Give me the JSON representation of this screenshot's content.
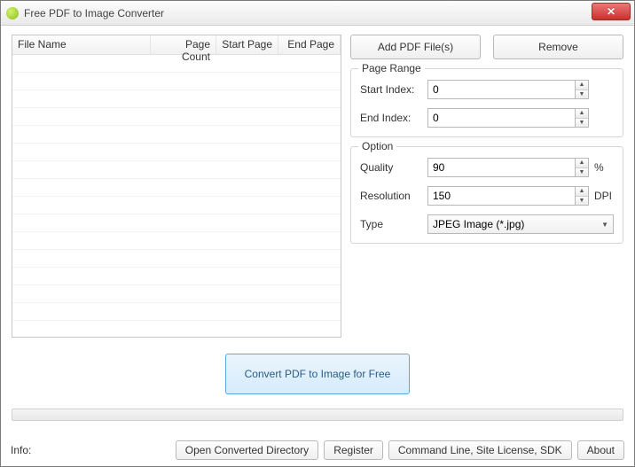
{
  "window": {
    "title": "Free PDF to Image Converter"
  },
  "file_list": {
    "headers": {
      "file_name": "File Name",
      "page_count": "Page Count",
      "start_page": "Start Page",
      "end_page": "End Page"
    }
  },
  "buttons": {
    "add": "Add PDF File(s)",
    "remove": "Remove",
    "convert": "Convert PDF to Image for Free",
    "open_dir": "Open Converted Directory",
    "register": "Register",
    "cmd": "Command Line, Site License, SDK",
    "about": "About"
  },
  "page_range": {
    "legend": "Page Range",
    "start_label": "Start Index:",
    "start_value": "0",
    "end_label": "End Index:",
    "end_value": "0"
  },
  "option": {
    "legend": "Option",
    "quality_label": "Quality",
    "quality_value": "90",
    "quality_suffix": "%",
    "resolution_label": "Resolution",
    "resolution_value": "150",
    "resolution_suffix": "DPI",
    "type_label": "Type",
    "type_value": "JPEG Image (*.jpg)"
  },
  "footer": {
    "info": "Info:"
  }
}
